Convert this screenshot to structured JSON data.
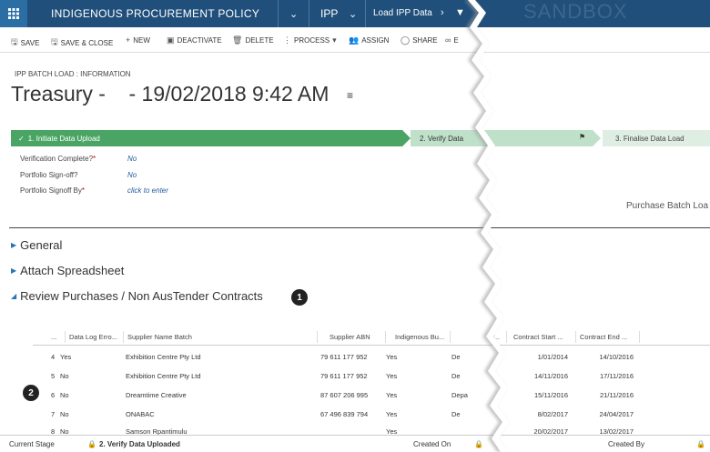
{
  "nav": {
    "app_title": "INDIGENOUS PROCUREMENT POLICY",
    "module": "IPP",
    "entity": "Load IPP Data",
    "environment": "SANDBOX"
  },
  "commands": {
    "save": "SAVE",
    "save_close": "SAVE & CLOSE",
    "new": "NEW",
    "deactivate": "DEACTIVATE",
    "delete": "DELETE",
    "process": "PROCESS",
    "assign": "ASSIGN",
    "share": "SHARE",
    "email_partial": "E"
  },
  "header": {
    "breadcrumb": "IPP BATCH LOAD : INFORMATION",
    "title": "Treasury -    - 19/02/2018 9:42 AM"
  },
  "process": {
    "stage1": "1. Initiate Data Upload",
    "stage2": "2. Verify Data",
    "stage3": "3. Finalise Data Load",
    "colors": {
      "active": "#4aa564",
      "next": "#bfe0c9",
      "future": "#dfeee3"
    }
  },
  "fields": [
    {
      "label": "Verification Complete?",
      "required": true,
      "value": "No"
    },
    {
      "label": "Portfolio Sign-off?",
      "required": false,
      "value": "No"
    },
    {
      "label": "Portfolio Signoff By",
      "required": true,
      "value": "click to enter"
    }
  ],
  "right_panel_label": "Purchase Batch Loa",
  "sections": {
    "general": "General",
    "attach": "Attach Spreadsheet",
    "review": "Review Purchases / Non AusTender Contracts"
  },
  "badges": {
    "one": "1",
    "two": "2"
  },
  "grid": {
    "columns": {
      "num": "...",
      "log": "Data Log Erro...",
      "supplier": "Supplier Name Batch",
      "abn": "Supplier ABN",
      "indigenous": "Indigenous Bu...",
      "dept": "F...",
      "start": "Contract Start ...",
      "end": "Contract End ..."
    },
    "rows": [
      {
        "num": "4",
        "log": "Yes",
        "supplier": "Exhibition Centre Pty Ltd",
        "abn": "79 611 177 952",
        "indigenous": "Yes",
        "dept": "De",
        "start": "1/01/2014",
        "end": "14/10/2016"
      },
      {
        "num": "5",
        "log": "No",
        "supplier": "Exhibition Centre Pty Ltd",
        "abn": "79 611 177 952",
        "indigenous": "Yes",
        "dept": "De",
        "start": "14/11/2016",
        "end": "17/11/2016"
      },
      {
        "num": "6",
        "log": "No",
        "supplier": "Dreamtime Creative",
        "abn": "87 607 206 995",
        "indigenous": "Yes",
        "dept": "Depa",
        "start": "15/11/2016",
        "end": "21/11/2016"
      },
      {
        "num": "7",
        "log": "No",
        "supplier": "ONABAC",
        "abn": "67 496 839 794",
        "indigenous": "Yes",
        "dept": "De",
        "start": "8/02/2017",
        "end": "24/04/2017"
      },
      {
        "num": "8",
        "log": "No",
        "supplier": "Samson Rpantimulu",
        "abn": "",
        "indigenous": "Yes",
        "dept": "",
        "start": "20/02/2017",
        "end": "13/02/2017"
      }
    ]
  },
  "footer": {
    "current_stage_label": "Current Stage",
    "current_stage_value": "2. Verify Data Uploaded",
    "created_on": "Created On",
    "created_by": "Created By"
  }
}
